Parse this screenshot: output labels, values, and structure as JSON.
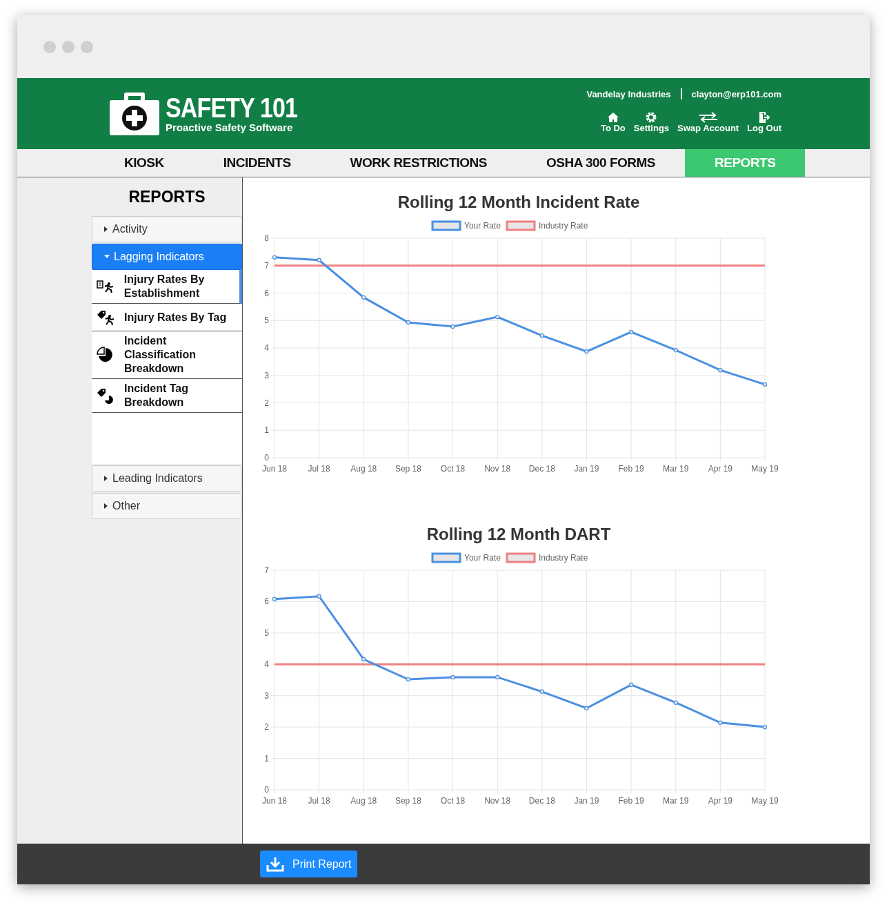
{
  "header": {
    "logo_title": "SAFETY 101",
    "logo_subtitle": "Proactive Safety Software",
    "company": "Vandelay Industries",
    "email": "clayton@erp101.com",
    "links": [
      {
        "label": "To Do",
        "kind": "home"
      },
      {
        "label": "Settings",
        "kind": "gear"
      },
      {
        "label": "Swap Account",
        "kind": "swap"
      },
      {
        "label": "Log Out",
        "kind": "logout"
      }
    ]
  },
  "tabs": [
    {
      "label": "KIOSK",
      "selected": false
    },
    {
      "label": "INCIDENTS",
      "selected": false
    },
    {
      "label": "WORK RESTRICTIONS",
      "selected": false
    },
    {
      "label": "OSHA 300 FORMS",
      "selected": false
    },
    {
      "label": "REPORTS",
      "selected": true
    }
  ],
  "sidebar": {
    "title": "REPORTS",
    "sections": [
      {
        "label": "Activity",
        "expanded": false
      },
      {
        "label": "Lagging Indicators",
        "expanded": true,
        "items": [
          {
            "label": "Injury Rates By Establishment",
            "kind": "establishment",
            "selected": true
          },
          {
            "label": "Injury Rates By Tag",
            "kind": "tag",
            "selected": false
          },
          {
            "label": "Incident Classification Breakdown",
            "kind": "classification",
            "selected": false
          },
          {
            "label": "Incident Tag Breakdown",
            "kind": "breakdown",
            "selected": false
          }
        ]
      },
      {
        "label": "Leading Indicators",
        "expanded": false
      },
      {
        "label": "Other",
        "expanded": false
      }
    ]
  },
  "charts": [
    {
      "chart_data": {
        "type": "line",
        "title": "Rolling 12 Month Incident Rate",
        "categories": [
          "Jun 18",
          "Jul 18",
          "Aug 18",
          "Sep 18",
          "Oct 18",
          "Nov 18",
          "Dec 18",
          "Jan 19",
          "Feb 19",
          "Mar 19",
          "Apr 19",
          "May 19"
        ],
        "grid": true,
        "legend": "top",
        "series": [
          {
            "name": "Your Rate",
            "color": "#4a90e2",
            "marker": "circle",
            "values": [
              7.3,
              7.2,
              5.84,
              4.93,
              4.78,
              5.13,
              4.45,
              3.87,
              4.58,
              3.92,
              3.19,
              2.67
            ]
          },
          {
            "name": "Industry Rate",
            "color": "#f08080",
            "values": [
              7.0,
              7.0,
              7.0,
              7.0,
              7.0,
              7.0,
              7.0,
              7.0,
              7.0,
              7.0,
              7.0,
              7.0
            ]
          }
        ],
        "ylim": [
          0,
          8
        ],
        "yticks": [
          0,
          1,
          2,
          3,
          4,
          5,
          6,
          7,
          8
        ]
      }
    },
    {
      "chart_data": {
        "type": "line",
        "title": "Rolling 12 Month DART",
        "categories": [
          "Jun 18",
          "Jul 18",
          "Aug 18",
          "Sep 18",
          "Oct 18",
          "Nov 18",
          "Dec 18",
          "Jan 19",
          "Feb 19",
          "Mar 19",
          "Apr 19",
          "May 19"
        ],
        "grid": true,
        "legend": "top",
        "series": [
          {
            "name": "Your Rate",
            "color": "#4a90e2",
            "marker": "circle",
            "values": [
              6.08,
              6.17,
              4.16,
              3.52,
              3.59,
              3.59,
              3.13,
              2.6,
              3.35,
              2.78,
              2.14,
              2.0
            ]
          },
          {
            "name": "Industry Rate",
            "color": "#f08080",
            "values": [
              4.0,
              4.0,
              4.0,
              4.0,
              4.0,
              4.0,
              4.0,
              4.0,
              4.0,
              4.0,
              4.0,
              4.0
            ]
          }
        ],
        "ylim": [
          0,
          7
        ],
        "yticks": [
          0,
          1,
          2,
          3,
          4,
          5,
          6,
          7
        ]
      }
    }
  ],
  "footer": {
    "button": "Print Report"
  }
}
